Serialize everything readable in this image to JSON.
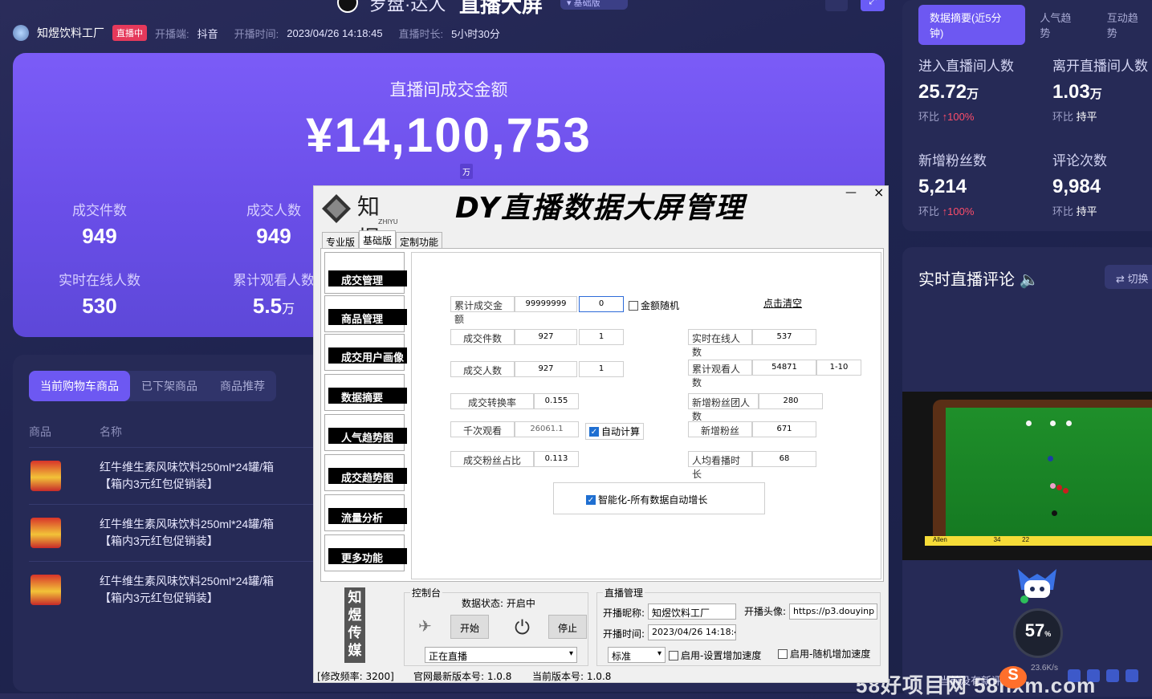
{
  "header": {
    "brand": "罗盘·达人",
    "title": "直播大屏",
    "version_pill": "基础版",
    "shop_name": "知煜饮料工厂",
    "live_badge": "直播中",
    "platform_label": "开播端:",
    "platform": "抖音",
    "start_label": "开播时间:",
    "start_time": "2023/04/26 14:18:45",
    "duration_label": "直播时长:",
    "duration": "5小时30分"
  },
  "hero": {
    "title": "直播间成交金额",
    "amount": "¥14,100,753",
    "unit": "万",
    "stats": [
      {
        "label": "成交件数",
        "value": "949"
      },
      {
        "label": "成交人数",
        "value": "949"
      },
      {
        "label": "实时在线人数",
        "value": "530"
      },
      {
        "label": "累计观看人数",
        "value": "5.5",
        "unit": "万"
      }
    ]
  },
  "products": {
    "tabs": [
      "当前购物车商品",
      "已下架商品",
      "商品推荐"
    ],
    "col_product": "商品",
    "col_name": "名称",
    "rows": [
      {
        "line1": "红牛维生素风味饮料250ml*24罐/箱",
        "line2": "【箱内3元红包促销装】"
      },
      {
        "line1": "红牛维生素风味饮料250ml*24罐/箱",
        "line2": "【箱内3元红包促销装】"
      },
      {
        "line1": "红牛维生素风味饮料250ml*24罐/箱",
        "line2": "【箱内3元红包促销装】"
      }
    ]
  },
  "summary": {
    "tabs": [
      "数据摘要(近5分钟)",
      "人气趋势",
      "互动趋势"
    ],
    "metrics": [
      {
        "label": "进入直播间人数",
        "value": "25.72",
        "unit": "万",
        "cmp_label": "环比",
        "cmp": "↑100%",
        "cmp_type": "up"
      },
      {
        "label": "离开直播间人数",
        "value": "1.03",
        "unit": "万",
        "cmp_label": "环比",
        "cmp": "持平",
        "cmp_type": "flat"
      },
      {
        "label": "新增粉丝数",
        "value": "5,214",
        "unit": "",
        "cmp_label": "环比",
        "cmp": "↑100%",
        "cmp_type": "up"
      },
      {
        "label": "评论次数",
        "value": "9,984",
        "unit": "",
        "cmp_label": "环比",
        "cmp": "持平",
        "cmp_type": "flat"
      }
    ]
  },
  "comments": {
    "title": "实时直播评论",
    "switch": "⇄ 切换",
    "footer": "当前没有新评论",
    "video_player": "Allen",
    "video_score_1": "34",
    "video_score_2": "22",
    "gauge_value": "57",
    "gauge_unit": "%",
    "gauge_speed": "23.6K/s"
  },
  "watermark": "58好项目网 58hxm.com",
  "app": {
    "logo_cn": "知煜",
    "logo_en": "ZHIYU",
    "title": "DY直播数据大屏管理",
    "tabs": [
      "专业版",
      "基础版",
      "定制功能"
    ],
    "side_buttons": [
      "成交管理",
      "商品管理",
      "成交用户画像",
      "数据摘要",
      "人气趋势图",
      "成交趋势图",
      "流量分析",
      "更多功能"
    ],
    "fields": {
      "total_amount_label": "累计成交金额",
      "total_amount": "99999999",
      "total_amount_inc": "0",
      "random_amount": "金额随机",
      "clear_link": "点击清空",
      "deal_count_label": "成交件数",
      "deal_count": "927",
      "deal_count_inc": "1",
      "deal_people_label": "成交人数",
      "deal_people": "927",
      "deal_people_inc": "1",
      "conv_rate_label": "成交转换率",
      "conv_rate": "0.155",
      "kview_label": "千次观看",
      "kview": "26061.1",
      "auto_calc": "自动计算",
      "fans_ratio_label": "成交粉丝占比",
      "fans_ratio": "0.113",
      "online_label": "实时在线人数",
      "online": "537",
      "viewers_label": "累计观看人数",
      "viewers": "54871",
      "viewers_range": "1-10",
      "fan_group_label": "新增粉丝团人数",
      "fan_group": "280",
      "new_fans_label": "新增粉丝",
      "new_fans": "671",
      "avg_time_label": "人均看播时长",
      "avg_time": "68",
      "smart_growth": "智能化-所有数据自动增长"
    },
    "brand_vertical": "知煜传媒",
    "console": {
      "title": "控制台",
      "status_label": "数据状态:",
      "status": "开启中",
      "start": "开始",
      "stop": "停止",
      "mode": "正在直播"
    },
    "live": {
      "title": "直播管理",
      "nick_label": "开播昵称:",
      "nick": "知煜饮料工厂",
      "avatar_label": "开播头像:",
      "avatar_url": "https://p3.douyinp",
      "time_label": "开播时间:",
      "time": "2023/04/26 14:18:4",
      "speed_mode": "标准",
      "custom_speed": "启用-设置增加速度",
      "random_speed": "启用-随机增加速度"
    },
    "status_bar": {
      "freq": "[修改频率: 3200]",
      "latest": "官网最新版本号: 1.0.8",
      "current": "当前版本号: 1.0.8"
    }
  },
  "colors": {
    "accent": "#6d58f2",
    "up": "#ff4d6a",
    "live": "#e5395b"
  }
}
